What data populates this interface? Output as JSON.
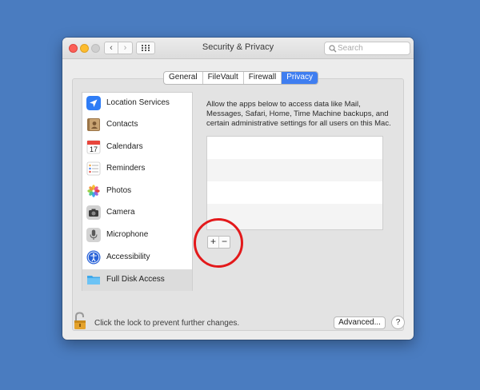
{
  "window": {
    "title": "Security & Privacy"
  },
  "toolbar": {
    "back_glyph": "‹",
    "forward_glyph": "›",
    "search_placeholder": "Search"
  },
  "tabs": [
    {
      "label": "General",
      "active": false
    },
    {
      "label": "FileVault",
      "active": false
    },
    {
      "label": "Firewall",
      "active": false
    },
    {
      "label": "Privacy",
      "active": true
    }
  ],
  "apps": [
    {
      "label": "Location Services",
      "icon": "location-arrow-icon",
      "selected": false
    },
    {
      "label": "Contacts",
      "icon": "contacts-book-icon",
      "selected": false
    },
    {
      "label": "Calendars",
      "icon": "calendar-icon",
      "calendar_day": "17",
      "selected": false
    },
    {
      "label": "Reminders",
      "icon": "reminders-list-icon",
      "selected": false
    },
    {
      "label": "Photos",
      "icon": "photos-flower-icon",
      "selected": false
    },
    {
      "label": "Camera",
      "icon": "camera-icon",
      "selected": false
    },
    {
      "label": "Microphone",
      "icon": "microphone-icon",
      "selected": false
    },
    {
      "label": "Accessibility",
      "icon": "accessibility-icon",
      "selected": false
    },
    {
      "label": "Full Disk Access",
      "icon": "folder-icon",
      "selected": true
    }
  ],
  "privacy": {
    "description": "Allow the apps below to access data like Mail, Messages, Safari, Home, Time Machine backups, and certain administrative settings for all users on this Mac.",
    "add_glyph": "+",
    "remove_glyph": "−"
  },
  "footer": {
    "lock_text": "Click the lock to prevent further changes.",
    "advanced_label": "Advanced...",
    "help_label": "?"
  },
  "colors": {
    "desktop": "#4a7cc0",
    "accent": "#3f7ef0",
    "annotation": "#e3191b"
  }
}
